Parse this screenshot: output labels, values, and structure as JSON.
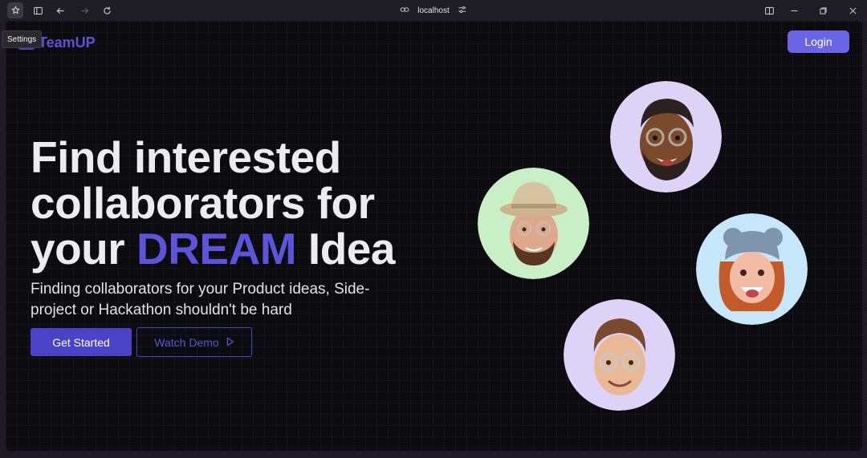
{
  "browser": {
    "url": "localhost",
    "tooltip": "Settings",
    "icons": [
      "settings-icon",
      "sidebar-toggle-icon",
      "back-arrow-icon",
      "forward-arrow-icon",
      "refresh-icon",
      "link-icon",
      "site-controls-icon",
      "split-view-icon",
      "minimize-icon",
      "restore-icon",
      "close-icon"
    ]
  },
  "navbar": {
    "logo_text": "TeamUP",
    "login_label": "Login"
  },
  "hero": {
    "title_line1": "Find interested",
    "title_line2": "collaborators for",
    "title_line3_start": "your",
    "title_accent": "DREAM",
    "title_line3_end": "Idea",
    "subtitle": "Finding collaborators for your Product ideas, Side-project or Hackathon shouldn't be hard",
    "primary_cta": "Get Started",
    "secondary_cta": "Watch Demo"
  },
  "colors": {
    "accent": "#5c55dc",
    "login_bg": "#6a64e6",
    "primary_bg": "#4a43c8",
    "page_bg": "#0c0b0f",
    "avatar_lavender": "#dcd3f7",
    "avatar_mint": "#c8efc6",
    "avatar_sky": "#c6e6fa"
  },
  "avatars": [
    {
      "name": "memoji-bearded-glasses",
      "bg": "#dcd3f7"
    },
    {
      "name": "memoji-hat-beard",
      "bg": "#c8efc6"
    },
    {
      "name": "memoji-redhead-beanie",
      "bg": "#c6e6fa"
    },
    {
      "name": "memoji-glasses-smile",
      "bg": "#dcd3f7"
    }
  ]
}
